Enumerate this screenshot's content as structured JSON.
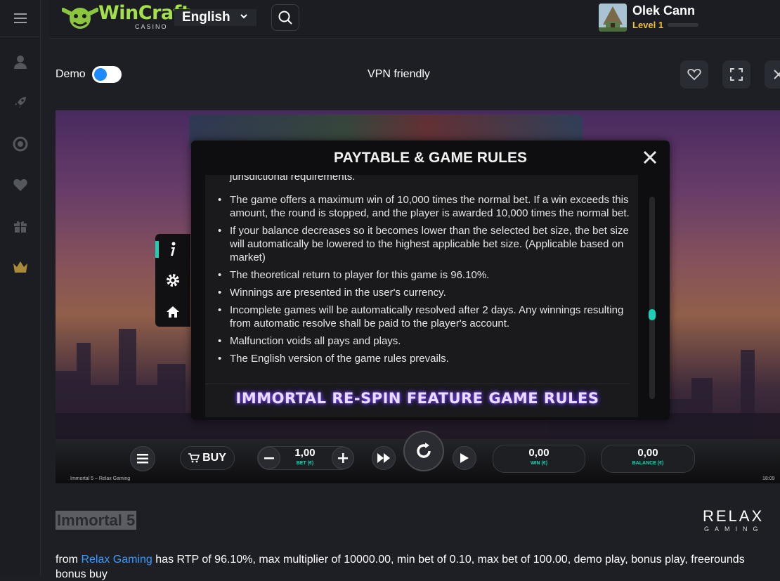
{
  "sidebar": {
    "icons": [
      "menu-icon",
      "user-icon",
      "rocket-icon",
      "lifebuoy-icon",
      "heart-icon",
      "gift-icon",
      "crown-icon"
    ]
  },
  "header": {
    "logo_text": "WinCraft",
    "logo_sub": "CASINO",
    "language": "English",
    "user_name": "Olek Cann",
    "user_level": "Level 1"
  },
  "toolbar": {
    "demo_label": "Demo",
    "demo_on": true,
    "vpn_label": "VPN friendly"
  },
  "game": {
    "modal_title": "PAYTABLE & GAME RULES",
    "cut_text": "jurisdictional requirements.",
    "rules": [
      "The game offers a maximum win of 10,000 times the normal bet. If a win exceeds this amount, the round is stopped, and the player is awarded 10,000 times the normal bet.",
      "If your balance decreases so it becomes lower than the selected bet size, the bet size will automatically be lowered to the highest applicable bet size. (Applicable based on market)",
      "The theoretical return to player for this game is 96.10%.",
      "Winnings are presented in the user's currency.",
      "Incomplete games will be automatically resolved after 2 days. Any winnings resulting from automatic resolve shall be paid to the player's account.",
      "Malfunction voids all pays and plays.",
      "The English version of the game rules prevails."
    ],
    "section_heading": "IMMORTAL RE-SPIN FEATURE GAME RULES",
    "buy_label": "BUY",
    "bet_value": "1,00",
    "bet_label": "BET (€)",
    "win_value": "0,00",
    "win_label": "WIN (€)",
    "balance_value": "0,00",
    "balance_label": "BALANCE (€)",
    "footer_left": "Immortal 5 – Relax Gaming",
    "footer_right": "18:09"
  },
  "page": {
    "game_name": "Immortal 5",
    "provider_logo_big": "RELAX",
    "provider_logo_small": "GAMING",
    "desc_from": "from ",
    "desc_provider": "Relax Gaming",
    "desc_rest": " has RTP of 96.10%, max multiplier of 10000.00, min bet of 0.10, max bet of 100.00, demo play, bonus play, freerounds",
    "desc_line2": "bonus buy"
  }
}
